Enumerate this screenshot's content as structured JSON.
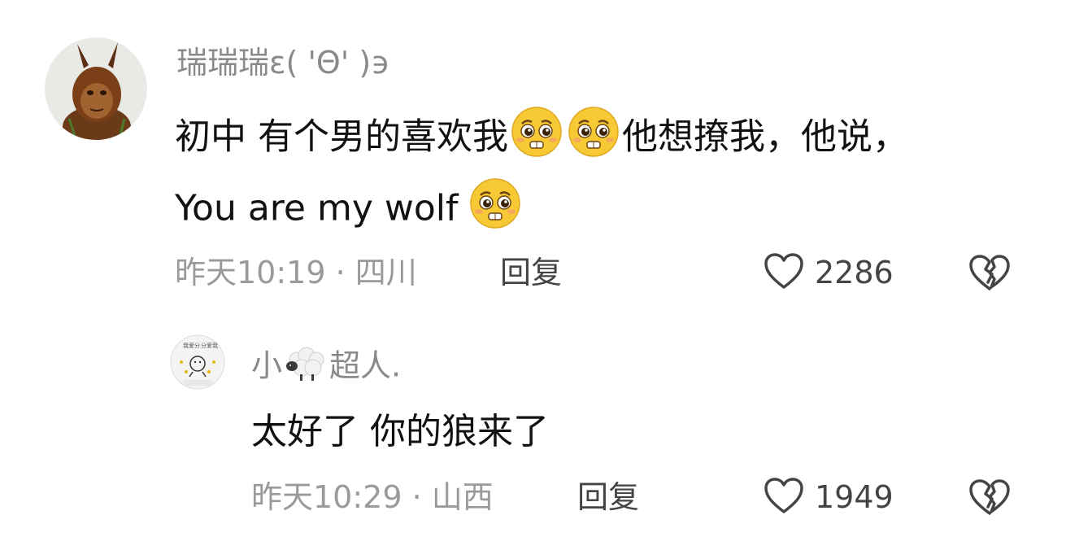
{
  "comments": [
    {
      "username": "瑞瑞瑞ε( 'Θ' )϶",
      "line1_text_a": "初中 有个男的喜欢我",
      "line1_text_b": "他想撩我，他说，",
      "line2_text": "You are my wolf",
      "emoji_icon": "pleading-face-icon",
      "time_location": "昨天10:19 · 四川",
      "reply_label": "回复",
      "like_count": "2286"
    },
    {
      "username_a": "小",
      "username_b": "超人.",
      "username_icon": "sheep-icon",
      "text": "太好了 你的狼来了",
      "time_location": "昨天10:29 · 山西",
      "reply_label": "回复",
      "like_count": "1949"
    }
  ],
  "icons": {
    "like": "heart-outline-icon",
    "dislike": "broken-heart-icon"
  },
  "colors": {
    "username": "#8a8a8a",
    "content": "#111111",
    "meta": "#9a9a9a",
    "action": "#444444",
    "emoji_face": "#f7c934"
  }
}
